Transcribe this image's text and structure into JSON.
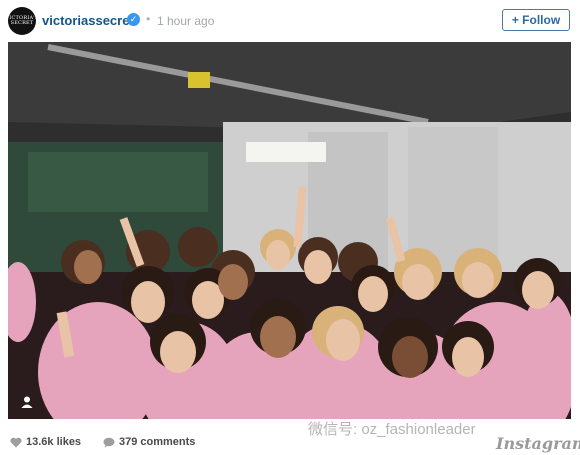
{
  "header": {
    "avatar_text": "VICTORIA'S SECRET",
    "username": "victoriassecret",
    "verified_icon": "check-icon",
    "separator": "•",
    "timestamp": "1 hour ago",
    "follow_label": "+ Follow"
  },
  "photo": {
    "icon": "user-tag-icon"
  },
  "footer": {
    "likes": "13.6k likes",
    "comments": "379 comments",
    "like_icon": "heart-icon",
    "comment_icon": "comment-icon"
  },
  "watermark": {
    "wechat": "微信号: oz_fashionleader",
    "brand": "Instagram"
  },
  "colors": {
    "username": "#125688",
    "follow_border": "#4a7ba6",
    "verified": "#3897f0",
    "robe": "#e8a0b8"
  }
}
